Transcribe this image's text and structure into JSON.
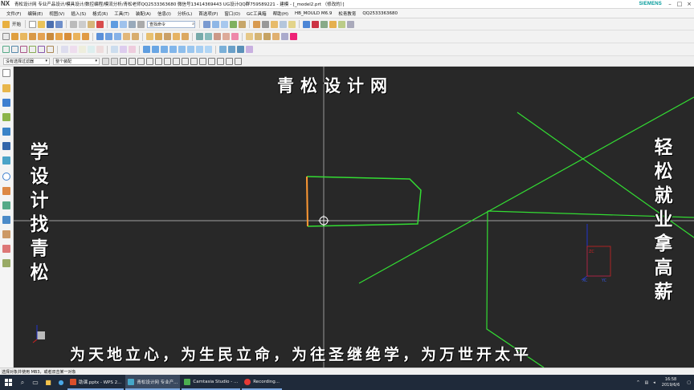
{
  "window": {
    "title": "青松设计网 专业产品设计/模具设计/数控编程/模流分析/青松老师QQ2533363680 微信号13414369443 UG设计QQ群759589221 - 建模 - [_model2.prt （修改的）]",
    "brand": "SIEMENS"
  },
  "menu": {
    "items": [
      "文件(F)",
      "编辑(E)",
      "视图(V)",
      "插入(S)",
      "格式(R)",
      "工具(T)",
      "装配(A)",
      "信息(I)",
      "分析(L)",
      "首选项(P)",
      "窗口(O)",
      "GC工具箱",
      "帮助(H)",
      "HB_MOULD M6.9",
      "松青教育",
      "QQ2533363680"
    ]
  },
  "toolbar": {
    "start_label": "开始",
    "command_finder_placeholder": "查找命令",
    "selection_filter": "没有选择过滤器",
    "assembly_scope": "整个装配"
  },
  "canvas": {
    "top_text": "青松设计网",
    "left_text": "学设计找青松",
    "right_text": "轻松就业拿高薪",
    "bottom_text": "为天地立心，为生民立命，为往圣继绝学，为万世开太平",
    "triad": {
      "xc": "XC",
      "yc": "YC",
      "zc": "ZC"
    },
    "colors": {
      "background": "#282828",
      "sketch": "#33dd33",
      "highlight": "#ff9933",
      "crosshair": "#c8c8c8"
    }
  },
  "status": {
    "prompt": "选择对象并使用 MB3，或者双击某一对象"
  },
  "taskbar": {
    "apps": [
      "助课.pptx - WPS 2...",
      "青松设计网 专业产...",
      "Camtasia Studio - ...",
      "Recording..."
    ],
    "time": "16:58",
    "date": "2019/6/6"
  }
}
